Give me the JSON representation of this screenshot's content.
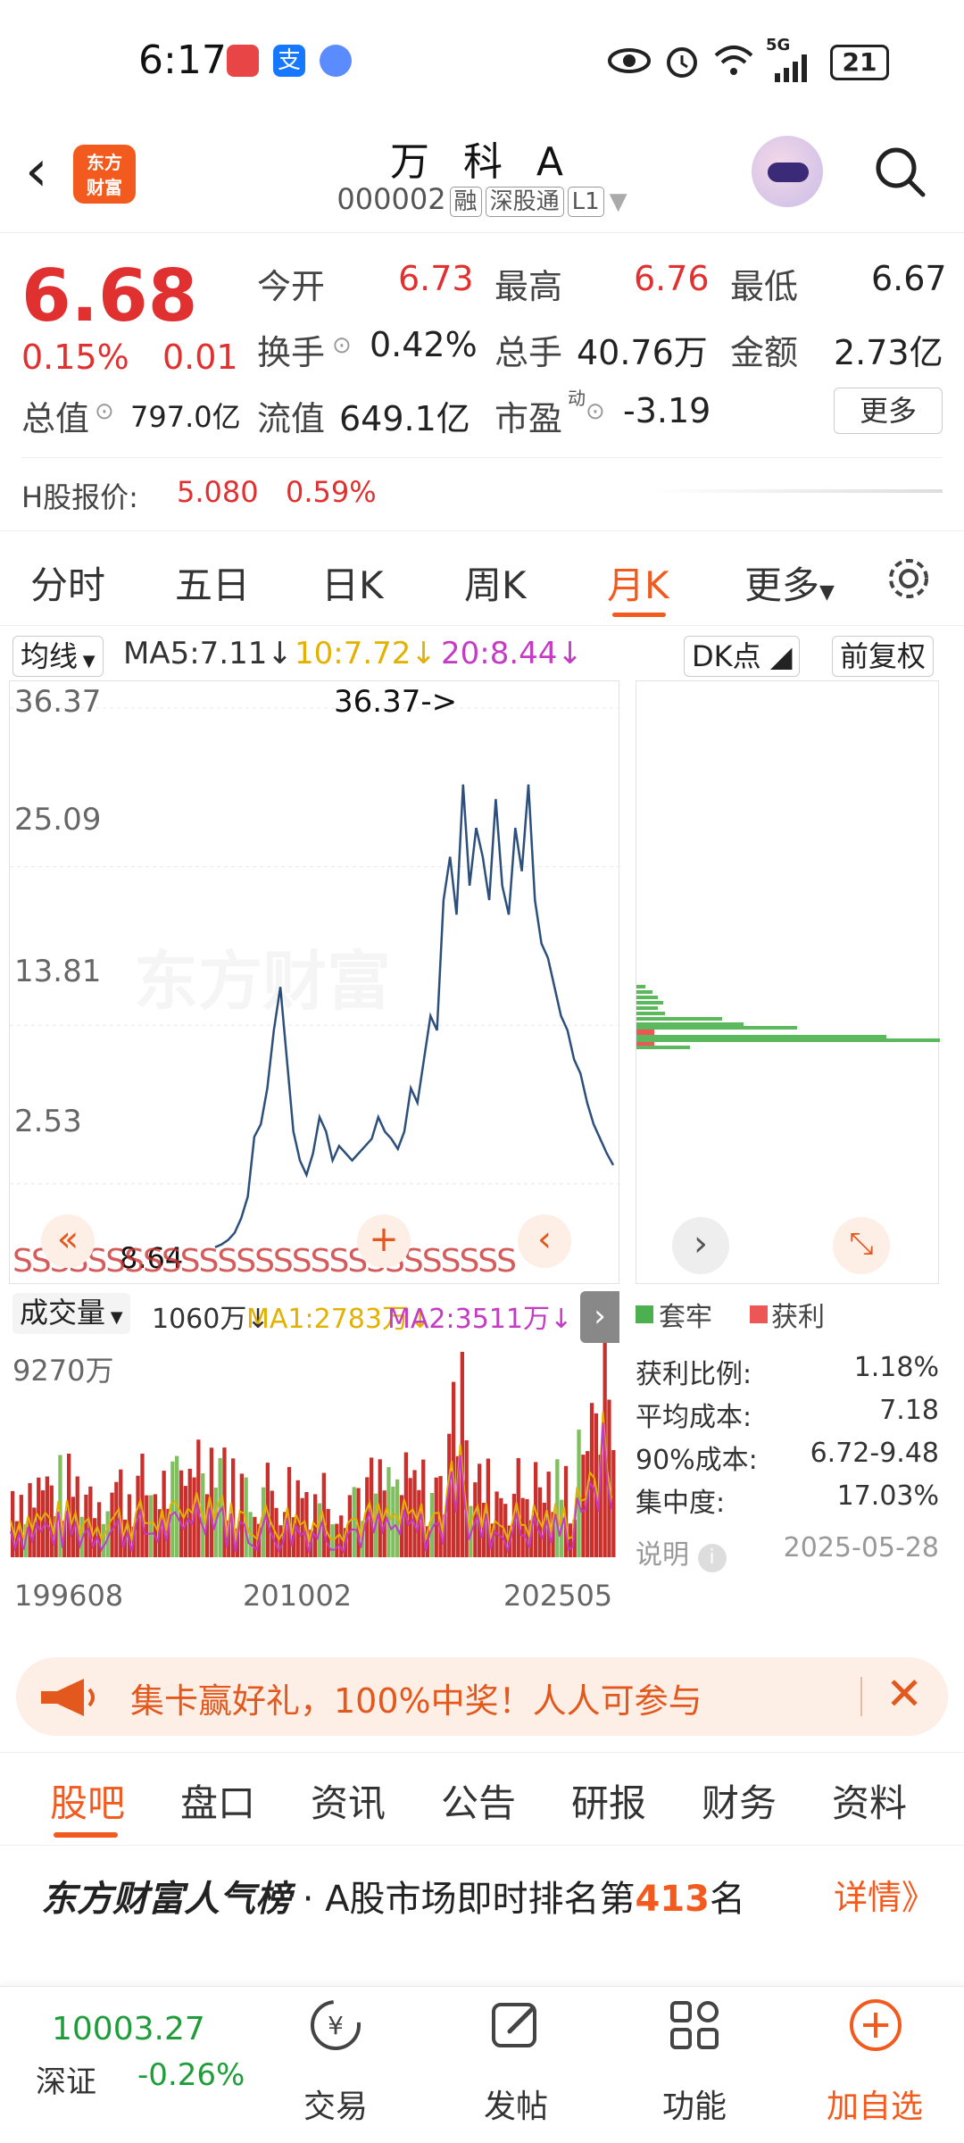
{
  "status": {
    "time": "6:17",
    "battery": "21",
    "network": "5G"
  },
  "header": {
    "title": "万 科 A",
    "code": "000002",
    "tags": [
      "融",
      "深股通",
      "L1"
    ],
    "logo_text_1": "东方",
    "logo_text_2": "财富"
  },
  "quote": {
    "price": "6.68",
    "change_pct": "0.15%",
    "change": "0.01",
    "open_label": "今开",
    "open": "6.73",
    "high_label": "最高",
    "high": "6.76",
    "low_label": "最低",
    "low": "6.67",
    "turnover_label": "换手",
    "turnover": "0.42%",
    "volume_label": "总手",
    "volume": "40.76万",
    "amount_label": "金额",
    "amount": "2.73亿",
    "mktcap_label": "总值",
    "mktcap": "797.0亿",
    "float_label": "流值",
    "float": "649.1亿",
    "pe_label": "市盈",
    "pe_sup": "动",
    "pe": "-3.19",
    "more_label": "更多",
    "h_label": "H股报价:",
    "h_price": "5.080",
    "h_pct": "0.59%"
  },
  "period_tabs": [
    "分时",
    "五日",
    "日K",
    "周K",
    "月K",
    "更多"
  ],
  "indicators": {
    "ma_chip": "均线",
    "ma5": "MA5:7.11",
    "ma10": "10:7.72",
    "ma20": "20:8.44",
    "dk_chip": "DK点",
    "adjust_chip": "前复权"
  },
  "chart": {
    "y_ticks": [
      "36.37",
      "25.09",
      "13.81",
      "2.53"
    ],
    "max_label": "36.37->",
    "min_label": "8.64"
  },
  "chart_data": {
    "type": "line",
    "x_ticks": [
      "199608",
      "201002",
      "202505"
    ],
    "y_ticks": [
      36.37,
      25.09,
      13.81,
      2.53
    ],
    "ylim": [
      2.53,
      36.37
    ],
    "values": [
      1.0,
      1.2,
      1.5,
      2.0,
      3.0,
      4.5,
      8.64,
      9.5,
      12,
      16,
      19,
      14,
      9,
      7,
      6,
      7.5,
      10,
      9,
      7,
      8,
      7.5,
      7,
      7.5,
      8,
      8.5,
      10,
      9,
      8.5,
      7.8,
      9,
      12,
      11,
      14,
      17,
      16,
      25,
      28,
      24,
      33,
      26,
      30,
      28,
      25,
      32,
      26,
      24,
      30,
      27,
      33,
      25,
      22,
      21,
      19,
      17,
      16,
      14,
      13,
      11,
      9.5,
      8.5,
      7.5,
      6.68
    ]
  },
  "volume": {
    "chip": "成交量",
    "vol": "1060万",
    "ma1": "MA1:2783万",
    "ma2": "MA2:3511万",
    "max_label": "9270万",
    "x_ticks": [
      "199608",
      "201002",
      "202505"
    ]
  },
  "distribution": {
    "legend_trapped": "套牢",
    "legend_profit": "获利",
    "profit_ratio_label": "获利比例:",
    "profit_ratio": "1.18%",
    "avg_cost_label": "平均成本:",
    "avg_cost": "7.18",
    "cost90_label": "90%成本:",
    "cost90": "6.72-9.48",
    "concentration_label": "集中度:",
    "concentration": "17.03%",
    "note_label": "说明",
    "date": "2025-05-28"
  },
  "banner": {
    "text": "集卡赢好礼，100%中奖！人人可参与"
  },
  "sub_tabs": [
    "股吧",
    "盘口",
    "资讯",
    "公告",
    "研报",
    "财务",
    "资料"
  ],
  "rank": {
    "brand": "东方财富人气榜",
    "text_prefix": "· A股市场即时排名第",
    "number": "413",
    "text_suffix": "名",
    "detail": "详情》"
  },
  "bottom_nav": {
    "index_value": "10003.27",
    "index_name": "深证",
    "index_change": "-0.26%",
    "items": [
      "交易",
      "发帖",
      "功能",
      "加自选"
    ]
  },
  "colors": {
    "accent": "#f25a1e",
    "up": "#e03030",
    "down": "#1f9d3a",
    "line": "#2c4f7c"
  }
}
